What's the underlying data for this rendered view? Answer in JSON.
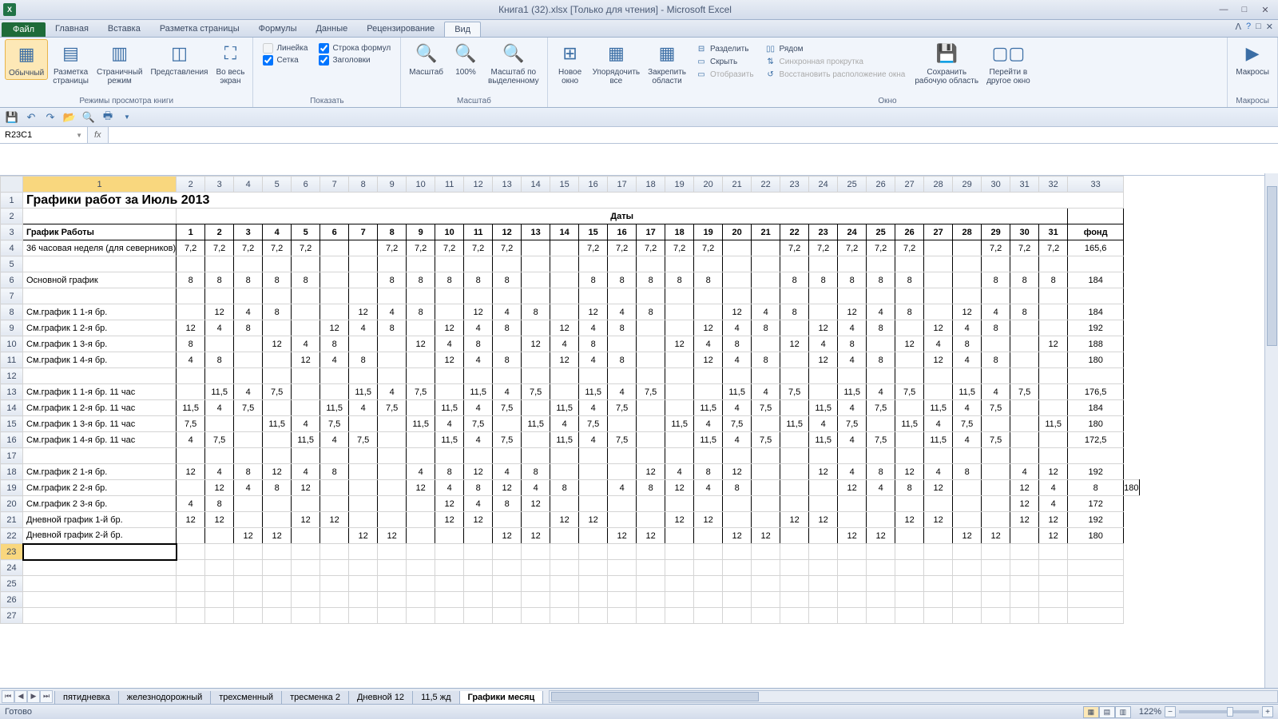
{
  "title": "Книга1 (32).xlsx  [Только для чтения] - Microsoft Excel",
  "tabs": {
    "file": "Файл",
    "list": [
      "Главная",
      "Вставка",
      "Разметка страницы",
      "Формулы",
      "Данные",
      "Рецензирование",
      "Вид"
    ],
    "active": "Вид"
  },
  "ribbon": {
    "g_views": {
      "label": "Режимы просмотра книги",
      "normal": "Обычный",
      "page_layout": "Разметка\nстраницы",
      "page_break": "Страничный\nрежим",
      "custom": "Представления",
      "full": "Во весь\nэкран"
    },
    "g_show": {
      "label": "Показать",
      "ruler": "Линейка",
      "formula_bar": "Строка формул",
      "gridlines": "Сетка",
      "headings": "Заголовки"
    },
    "g_zoom": {
      "label": "Масштаб",
      "zoom": "Масштаб",
      "p100": "100%",
      "sel": "Масштаб по\nвыделенному"
    },
    "g_window": {
      "label": "Окно",
      "new": "Новое\nокно",
      "arrange": "Упорядочить\nвсе",
      "freeze": "Закрепить\nобласти",
      "split": "Разделить",
      "hide": "Скрыть",
      "unhide": "Отобразить",
      "side": "Рядом",
      "sync": "Синхронная прокрутка",
      "reset": "Восстановить расположение окна",
      "save_ws": "Сохранить\nрабочую область",
      "switch": "Перейти в\nдругое окно"
    },
    "g_macros": {
      "label": "Макросы",
      "macros": "Макросы"
    }
  },
  "namebox": "R23C1",
  "sheet": {
    "title_row": "Графики работ за Июль 2013",
    "dates_header": "Даты",
    "schedule_header": "График Работы",
    "fund_header": "фонд",
    "days": [
      "1",
      "2",
      "3",
      "4",
      "5",
      "6",
      "7",
      "8",
      "9",
      "10",
      "11",
      "12",
      "13",
      "14",
      "15",
      "16",
      "17",
      "18",
      "19",
      "20",
      "21",
      "22",
      "23",
      "24",
      "25",
      "26",
      "27",
      "28",
      "29",
      "30",
      "31"
    ],
    "rows": [
      {
        "r": 4,
        "label": "36 часовая неделя (для северников)",
        "vals": [
          "7,2",
          "7,2",
          "7,2",
          "7,2",
          "7,2",
          "",
          "",
          "7,2",
          "7,2",
          "7,2",
          "7,2",
          "7,2",
          "",
          "",
          "7,2",
          "7,2",
          "7,2",
          "7,2",
          "7,2",
          "",
          "",
          "7,2",
          "7,2",
          "7,2",
          "7,2",
          "7,2",
          "",
          "",
          "7,2",
          "7,2",
          "7,2"
        ],
        "fund": "165,6"
      },
      {
        "r": 5,
        "label": "",
        "vals": [
          "",
          "",
          "",
          "",
          "",
          "",
          "",
          "",
          "",
          "",
          "",
          "",
          "",
          "",
          "",
          "",
          "",
          "",
          "",
          "",
          "",
          "",
          "",
          "",
          "",
          "",
          "",
          "",
          "",
          "",
          ""
        ],
        "fund": ""
      },
      {
        "r": 6,
        "label": "Основной график",
        "vals": [
          "8",
          "8",
          "8",
          "8",
          "8",
          "",
          "",
          "8",
          "8",
          "8",
          "8",
          "8",
          "",
          "",
          "8",
          "8",
          "8",
          "8",
          "8",
          "",
          "",
          "8",
          "8",
          "8",
          "8",
          "8",
          "",
          "",
          "8",
          "8",
          "8"
        ],
        "fund": "184"
      },
      {
        "r": 7,
        "label": "",
        "vals": [
          "",
          "",
          "",
          "",
          "",
          "",
          "",
          "",
          "",
          "",
          "",
          "",
          "",
          "",
          "",
          "",
          "",
          "",
          "",
          "",
          "",
          "",
          "",
          "",
          "",
          "",
          "",
          "",
          "",
          "",
          ""
        ],
        "fund": ""
      },
      {
        "r": 8,
        "label": "См.график 1   1-я бр.",
        "vals": [
          "",
          "12",
          "4",
          "8",
          "",
          "",
          "12",
          "4",
          "8",
          "",
          "12",
          "4",
          "8",
          "",
          "12",
          "4",
          "8",
          "",
          "",
          "12",
          "4",
          "8",
          "",
          "12",
          "4",
          "8",
          "",
          "12",
          "4",
          "8",
          ""
        ],
        "fund": "184"
      },
      {
        "r": 9,
        "label": "См.график 1   2-я бр.",
        "vals": [
          "12",
          "4",
          "8",
          "",
          "",
          "12",
          "4",
          "8",
          "",
          "12",
          "4",
          "8",
          "",
          "12",
          "4",
          "8",
          "",
          "",
          "12",
          "4",
          "8",
          "",
          "12",
          "4",
          "8",
          "",
          "12",
          "4",
          "8",
          "",
          ""
        ],
        "fund": "192"
      },
      {
        "r": 10,
        "label": "См.график 1   3-я бр.",
        "vals": [
          "8",
          "",
          "",
          "12",
          "4",
          "8",
          "",
          "",
          "12",
          "4",
          "8",
          "",
          "12",
          "4",
          "8",
          "",
          "",
          "12",
          "4",
          "8",
          "",
          "12",
          "4",
          "8",
          "",
          "12",
          "4",
          "8",
          "",
          "",
          "12"
        ],
        "fund": "188"
      },
      {
        "r": 11,
        "label": "См.график 1   4-я бр.",
        "vals": [
          "4",
          "8",
          "",
          "",
          "12",
          "4",
          "8",
          "",
          "",
          "12",
          "4",
          "8",
          "",
          "12",
          "4",
          "8",
          "",
          "",
          "12",
          "4",
          "8",
          "",
          "12",
          "4",
          "8",
          "",
          "12",
          "4",
          "8",
          "",
          ""
        ],
        "fund": "180"
      },
      {
        "r": 12,
        "label": "",
        "vals": [
          "",
          "",
          "",
          "",
          "",
          "",
          "",
          "",
          "",
          "",
          "",
          "",
          "",
          "",
          "",
          "",
          "",
          "",
          "",
          "",
          "",
          "",
          "",
          "",
          "",
          "",
          "",
          "",
          "",
          "",
          ""
        ],
        "fund": ""
      },
      {
        "r": 13,
        "label": "См.график 1   1-я бр. 11 час",
        "vals": [
          "",
          "11,5",
          "4",
          "7,5",
          "",
          "",
          "11,5",
          "4",
          "7,5",
          "",
          "11,5",
          "4",
          "7,5",
          "",
          "11,5",
          "4",
          "7,5",
          "",
          "",
          "11,5",
          "4",
          "7,5",
          "",
          "11,5",
          "4",
          "7,5",
          "",
          "11,5",
          "4",
          "7,5",
          ""
        ],
        "fund": "176,5"
      },
      {
        "r": 14,
        "label": "См.график 1   2-я бр. 11 час",
        "vals": [
          "11,5",
          "4",
          "7,5",
          "",
          "",
          "11,5",
          "4",
          "7,5",
          "",
          "11,5",
          "4",
          "7,5",
          "",
          "11,5",
          "4",
          "7,5",
          "",
          "",
          "11,5",
          "4",
          "7,5",
          "",
          "11,5",
          "4",
          "7,5",
          "",
          "11,5",
          "4",
          "7,5",
          "",
          ""
        ],
        "fund": "184"
      },
      {
        "r": 15,
        "label": "См.график 1   3-я бр. 11 час",
        "vals": [
          "7,5",
          "",
          "",
          "11,5",
          "4",
          "7,5",
          "",
          "",
          "11,5",
          "4",
          "7,5",
          "",
          "11,5",
          "4",
          "7,5",
          "",
          "",
          "11,5",
          "4",
          "7,5",
          "",
          "11,5",
          "4",
          "7,5",
          "",
          "11,5",
          "4",
          "7,5",
          "",
          "",
          "11,5"
        ],
        "fund": "180"
      },
      {
        "r": 16,
        "label": "См.график 1   4-я бр. 11 час",
        "vals": [
          "4",
          "7,5",
          "",
          "",
          "11,5",
          "4",
          "7,5",
          "",
          "",
          "11,5",
          "4",
          "7,5",
          "",
          "11,5",
          "4",
          "7,5",
          "",
          "",
          "11,5",
          "4",
          "7,5",
          "",
          "11,5",
          "4",
          "7,5",
          "",
          "11,5",
          "4",
          "7,5",
          "",
          ""
        ],
        "fund": "172,5"
      },
      {
        "r": 17,
        "label": "",
        "vals": [
          "",
          "",
          "",
          "",
          "",
          "",
          "",
          "",
          "",
          "",
          "",
          "",
          "",
          "",
          "",
          "",
          "",
          "",
          "",
          "",
          "",
          "",
          "",
          "",
          "",
          "",
          "",
          "",
          "",
          "",
          ""
        ],
        "fund": ""
      },
      {
        "r": 18,
        "label": "См.график 2   1-я бр.",
        "vals": [
          "12",
          "4",
          "8",
          "12",
          "4",
          "8",
          "",
          "",
          "4",
          "8",
          "12",
          "4",
          "8",
          "",
          "",
          "",
          "12",
          "4",
          "8",
          "12",
          "",
          "",
          "12",
          "4",
          "8",
          "12",
          "4",
          "8",
          "",
          "4",
          "12"
        ],
        "fund": "192"
      },
      {
        "r": 19,
        "label": "См.график 2   2-я бр.",
        "vals": [
          "",
          "12",
          "4",
          "8",
          "12",
          "",
          "",
          "",
          "12",
          "4",
          "8",
          "12",
          "4",
          "8",
          "",
          "4",
          "8",
          "12",
          "4",
          "8",
          "",
          "",
          "",
          "12",
          "4",
          "8",
          "12",
          "",
          "",
          "12",
          "4",
          "8"
        ],
        "fund": "180"
      },
      {
        "r": 20,
        "label": "См.график 2   3-я бр.",
        "vals": [
          "4",
          "8",
          "",
          "",
          "",
          "",
          "",
          "",
          "",
          "12",
          "4",
          "8",
          "12",
          "",
          "",
          "",
          "",
          "",
          "",
          "",
          "",
          "",
          "",
          "",
          "",
          "",
          "",
          "",
          "",
          "12",
          "4"
        ],
        "fund": "172"
      },
      {
        "r": 21,
        "label": "Дневной график 1-й бр.",
        "vals": [
          "12",
          "12",
          "",
          "",
          "12",
          "12",
          "",
          "",
          "",
          "12",
          "12",
          "",
          "",
          "12",
          "12",
          "",
          "",
          "12",
          "12",
          "",
          "",
          "12",
          "12",
          "",
          "",
          "12",
          "12",
          "",
          "",
          "12",
          "12"
        ],
        "fund": "192"
      },
      {
        "r": 22,
        "label": "Дневной график 2-й бр.",
        "vals": [
          "",
          "",
          "12",
          "12",
          "",
          "",
          "12",
          "12",
          "",
          "",
          "",
          "12",
          "12",
          "",
          "",
          "12",
          "12",
          "",
          "",
          "12",
          "12",
          "",
          "",
          "12",
          "12",
          "",
          "",
          "12",
          "12",
          "",
          "12"
        ],
        "fund": "180"
      }
    ],
    "col_headers": [
      "1",
      "2",
      "3",
      "4",
      "5",
      "6",
      "7",
      "8",
      "9",
      "10",
      "11",
      "12",
      "13",
      "14",
      "15",
      "16",
      "17",
      "18",
      "19",
      "20",
      "21",
      "22",
      "23",
      "24",
      "25",
      "26",
      "27",
      "28",
      "29",
      "30",
      "31",
      "32",
      "33"
    ]
  },
  "sheet_tabs": {
    "list": [
      "пятидневка",
      "железнодорожный",
      "трехсменный",
      "тресменка 2",
      "Дневной 12",
      "11,5 жд",
      "Графики месяц"
    ],
    "active": "Графики месяц"
  },
  "status": {
    "ready": "Готово",
    "zoom": "122%"
  }
}
